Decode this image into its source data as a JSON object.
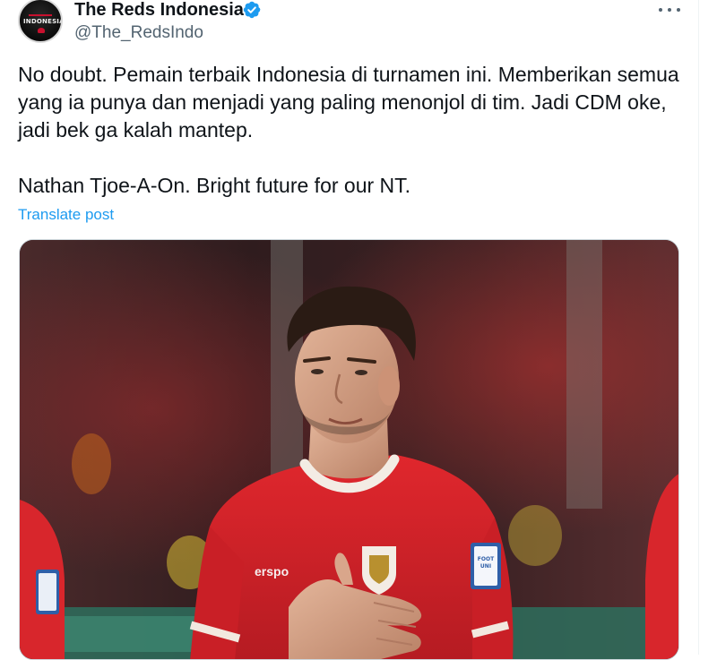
{
  "author": {
    "display_name": "The Reds Indonesia",
    "handle": "@The_RedsIndo",
    "avatar_text": "INDONESIA",
    "verified": true
  },
  "tweet": {
    "text": "No doubt. Pemain terbaik Indonesia di turnamen ini. Memberikan semua yang ia punya dan menjadi yang paling menonjol di tim. Jadi CDM oke, jadi bek ga kalah mantep.\n\nNathan Tjoe-A-On. Bright future for our NT.",
    "translate_label": "Translate post"
  },
  "media": {
    "jersey_brand": "erspo",
    "sleeve_patch": "FOOTBALL UNITES"
  },
  "colors": {
    "link": "#1d9bf0",
    "secondary_text": "#536471",
    "verified_badge": "#1d9bf0",
    "jersey_red": "#d8262c"
  },
  "icons": [
    "verified-badge-icon",
    "more-options-icon"
  ]
}
